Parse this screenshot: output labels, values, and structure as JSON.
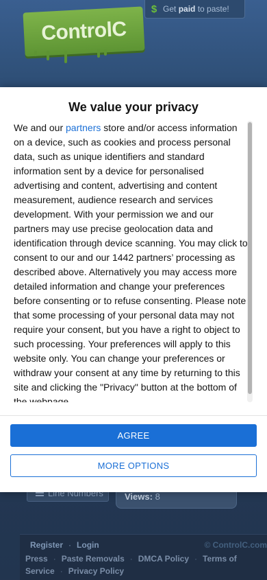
{
  "site": {
    "paid_banner": {
      "prefix": "Get ",
      "bold": "paid",
      "suffix": " to paste!",
      "icon": "dollar-icon"
    },
    "logo_text": "ControlC",
    "line_numbers_label": "Line Numbers",
    "views": {
      "label": "Views:",
      "value": "8"
    },
    "footer": {
      "register": "Register",
      "login": "Login",
      "copyright": "© ControlC.com",
      "links": [
        "Press",
        "Paste Removals",
        "DMCA Policy",
        "Terms of Service",
        "Privacy Policy"
      ]
    }
  },
  "consent": {
    "title": "We value your privacy",
    "text_before_link": "We and our ",
    "link_text": "partners",
    "text_after_link": " store and/or access information on a device, such as cookies and process personal data, such as unique identifiers and standard information sent by a device for personalised advertising and content, advertising and content measurement, audience research and services development. With your permission we and our partners may use precise geolocation data and identification through device scanning. You may click to consent to our and our 1442 partners’ processing as described above. Alternatively you may access more detailed information and change your preferences before consenting or to refuse consenting. Please note that some processing of your personal data may not require your consent, but you have a right to object to such processing. Your preferences will apply to this website only. You can change your preferences or withdraw your consent at any time by returning to this site and clicking the \"Privacy\" button at the bottom of the webpage.",
    "agree_label": "AGREE",
    "more_options_label": "MORE OPTIONS"
  },
  "colors": {
    "accent": "#1a6fd6",
    "logo_green": "#6ea53f",
    "site_background": "#23354f"
  }
}
